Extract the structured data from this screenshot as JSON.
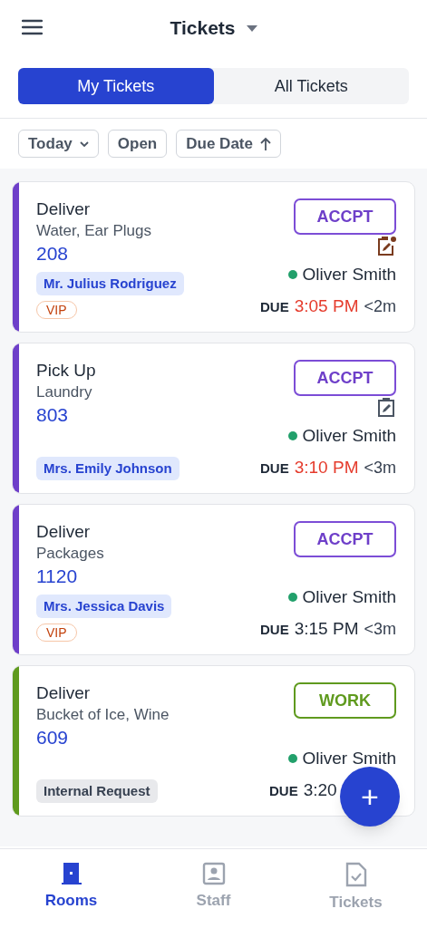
{
  "header": {
    "title": "Tickets"
  },
  "tabs": [
    {
      "label": "My Tickets",
      "selected": true
    },
    {
      "label": "All Tickets",
      "selected": false
    }
  ],
  "filters": [
    {
      "label": "Today",
      "kind": "dropdown"
    },
    {
      "label": "Open",
      "kind": "plain"
    },
    {
      "label": "Due Date",
      "kind": "sort"
    }
  ],
  "tickets": [
    {
      "color": "#6e3fc9",
      "type": "Deliver",
      "items": "Water, Ear Plugs",
      "room": "208",
      "action": {
        "label": "ACCPT",
        "kind": "accept"
      },
      "note": {
        "unread": true
      },
      "staff": "Oliver Smith",
      "due_label": "DUE",
      "due_time": "3:05 PM",
      "overdue": true,
      "remaining": "<2m",
      "tags": [
        {
          "label": "Mr. Julius Rodriguez",
          "kind": "guest"
        },
        {
          "label": "VIP",
          "kind": "vip"
        }
      ]
    },
    {
      "color": "#6e3fc9",
      "type": "Pick Up",
      "items": "Laundry",
      "room": "803",
      "action": {
        "label": "ACCPT",
        "kind": "accept"
      },
      "note": {
        "unread": false
      },
      "staff": "Oliver Smith",
      "due_label": "DUE",
      "due_time": "3:10 PM",
      "overdue": true,
      "remaining": "<3m",
      "tags": [
        {
          "label": "Mrs. Emily Johnson",
          "kind": "guest"
        }
      ]
    },
    {
      "color": "#6e3fc9",
      "type": "Deliver",
      "items": "Packages",
      "room": "1120",
      "action": {
        "label": "ACCPT",
        "kind": "accept"
      },
      "staff": "Oliver Smith",
      "due_label": "DUE",
      "due_time": "3:15 PM",
      "overdue": false,
      "remaining": "<3m",
      "tags": [
        {
          "label": "Mrs. Jessica Davis",
          "kind": "guest"
        },
        {
          "label": "VIP",
          "kind": "vip"
        }
      ]
    },
    {
      "color": "#5f9a1e",
      "type": "Deliver",
      "items": "Bucket of Ice, Wine",
      "room": "609",
      "action": {
        "label": "WORK",
        "kind": "work"
      },
      "staff": "Oliver Smith",
      "due_label": "DUE",
      "due_time": "3:20",
      "overdue": false,
      "tags": [
        {
          "label": "Internal Request",
          "kind": "internal"
        }
      ]
    }
  ],
  "fab": {
    "label": "+"
  },
  "nav": [
    {
      "label": "Rooms",
      "kind": "rooms",
      "selected": true
    },
    {
      "label": "Staff",
      "kind": "staff",
      "selected": false
    },
    {
      "label": "Tickets",
      "kind": "tickets",
      "selected": false
    }
  ]
}
